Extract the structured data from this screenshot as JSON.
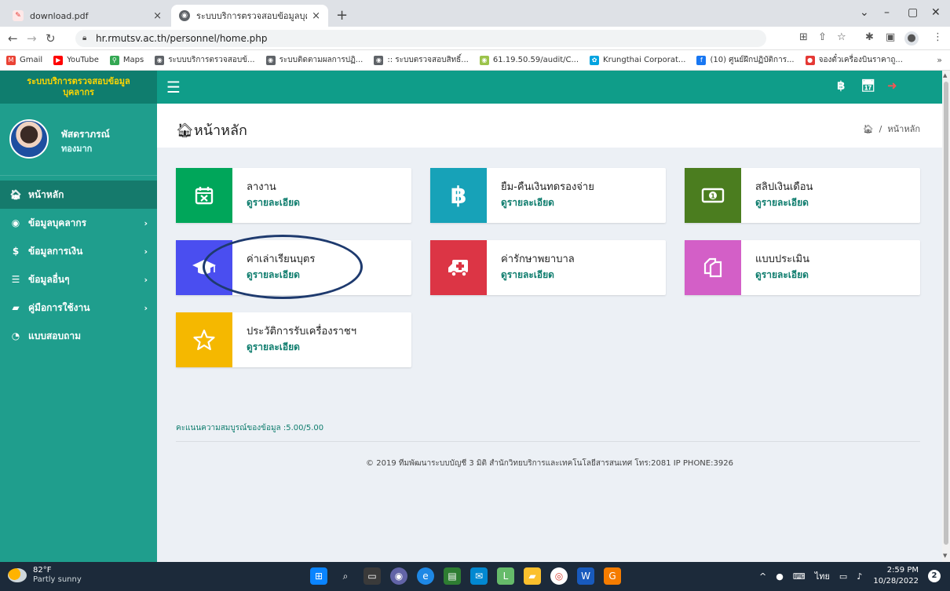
{
  "browser": {
    "tabs": [
      {
        "label": "download.pdf",
        "close": "×"
      },
      {
        "label": "ระบบบริการตรวจสอบข้อมูลบุคลากร",
        "close": "×"
      }
    ],
    "new_tab": "+",
    "window_controls": {
      "minimize": "–",
      "maximize": "▢",
      "close": "✕",
      "dropdown": "⌄"
    },
    "url": "hr.rmutsv.ac.th/personnel/home.php",
    "bookmarks": [
      {
        "label": "Gmail",
        "icon": "gmail-icon",
        "color": "#ea4335"
      },
      {
        "label": "YouTube",
        "icon": "youtube-icon",
        "color": "#ff0000"
      },
      {
        "label": "Maps",
        "icon": "maps-icon",
        "color": "#34a853"
      },
      {
        "label": "ระบบบริการตรวจสอบข้...",
        "icon": "globe-icon",
        "color": "#5f6368"
      },
      {
        "label": "ระบบติดตามผลการปฏิ...",
        "icon": "globe-icon",
        "color": "#5f6368"
      },
      {
        "label": ":: ระบบตรวจสอบสิทธิ์...",
        "icon": "globe-icon",
        "color": "#5f6368"
      },
      {
        "label": "61.19.50.59/audit/C...",
        "icon": "globe-icon",
        "color": "#9bc34a"
      },
      {
        "label": "Krungthai Corporat...",
        "icon": "krungthai-icon",
        "color": "#00a3e0"
      },
      {
        "label": "(10) ศูนย์ฝึกปฏิบัติการ...",
        "icon": "facebook-icon",
        "color": "#1877f2"
      },
      {
        "label": "จองตั๋วเครื่องบินราคาถู...",
        "icon": "airline-icon",
        "color": "#e53935"
      }
    ],
    "bookmarks_more": "»"
  },
  "app": {
    "brand": [
      "ระบบบริการตรวจสอบข้อมูล",
      "บุคลากร"
    ],
    "user": {
      "name": "พัสดราภรณ์",
      "surname": "ทองมาก"
    },
    "menu": [
      {
        "label": "หน้าหลัก",
        "icon": "home-icon",
        "active": true
      },
      {
        "label": "ข้อมูลบุคลากร",
        "icon": "user-circle-icon",
        "chevron": "›"
      },
      {
        "label": "ข้อมูลการเงิน",
        "icon": "dollar-icon",
        "chevron": "›"
      },
      {
        "label": "ข้อมูลอื่นๆ",
        "icon": "list-icon",
        "chevron": "›"
      },
      {
        "label": "คู่มือการใช้งาน",
        "icon": "book-icon",
        "chevron": "›"
      },
      {
        "label": "แบบสอบถาม",
        "icon": "pie-icon"
      }
    ],
    "page_title": "หน้าหลัก",
    "breadcrumb": "หน้าหลัก",
    "cards": [
      {
        "title": "ลางาน",
        "link": "ดูรายละเอียด",
        "icon": "calendar-x-icon",
        "color": "#00a65a"
      },
      {
        "title": "ยืม-คืนเงินทดรองจ่าย",
        "link": "ดูรายละเอียด",
        "icon": "baht-icon",
        "color": "#17a2b8"
      },
      {
        "title": "สลิปเงินเดือน",
        "link": "ดูรายละเอียด",
        "icon": "money-icon",
        "color": "#4b7d1f"
      },
      {
        "title": "ค่าเล่าเรียนบุตร",
        "link": "ดูรายละเอียด",
        "icon": "graduation-cap-icon",
        "color": "#4a4ef0"
      },
      {
        "title": "ค่ารักษาพยาบาล",
        "link": "ดูรายละเอียด",
        "icon": "ambulance-icon",
        "color": "#dc3545"
      },
      {
        "title": "แบบประเมิน",
        "link": "ดูรายละเอียด",
        "icon": "copy-icon",
        "color": "#d35fc7"
      },
      {
        "title": "ประวัติการรับเครื่องราชฯ",
        "link": "ดูรายละเอียด",
        "icon": "star-icon",
        "color": "#f5b800"
      }
    ],
    "score_text": "คะแนนความสมบูรณ์ของข้อมูล :5.00/5.00",
    "footer": "© 2019 ทีมพัฒนาระบบบัญชี 3 มิติ สำนักวิทยบริการและเทคโนโลยีสารสนเทศ โทร:2081 IP PHONE:3926"
  },
  "taskbar": {
    "weather_temp": "82°F",
    "weather_desc": "Partly sunny",
    "lang": "ไทย",
    "time": "2:59 PM",
    "date": "10/28/2022",
    "notif_count": "2"
  }
}
